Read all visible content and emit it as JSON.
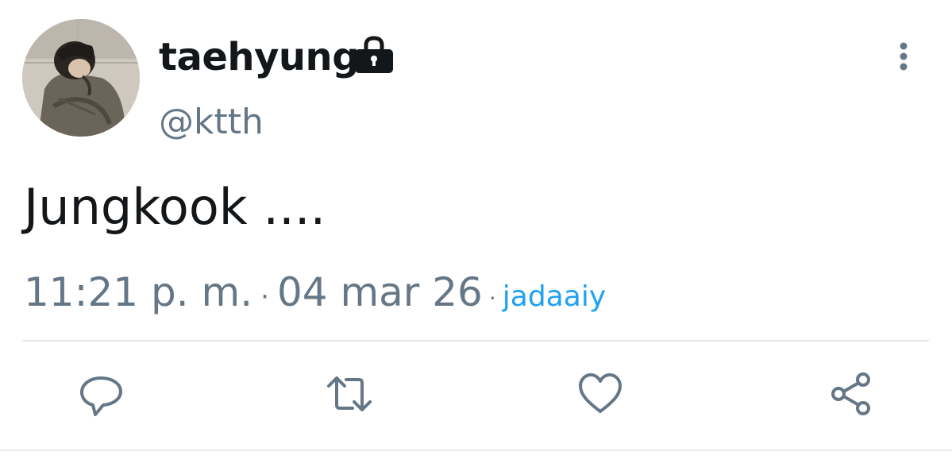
{
  "tweet": {
    "display_name": "taehyung",
    "handle": "@ktth",
    "text": "Jungkook ....",
    "time": "11:21 p. m.",
    "separator": "·",
    "date": "04 mar 26",
    "source": "jadaaiy",
    "protected": true
  },
  "icons": {
    "lock": "lock-icon",
    "more": "more-vertical-icon",
    "reply": "reply-icon",
    "retweet": "retweet-icon",
    "like": "heart-icon",
    "share": "share-icon"
  },
  "colors": {
    "name": "#14171a",
    "secondary": "#657786",
    "link": "#1da1f2",
    "divider": "#e1e8ed"
  }
}
